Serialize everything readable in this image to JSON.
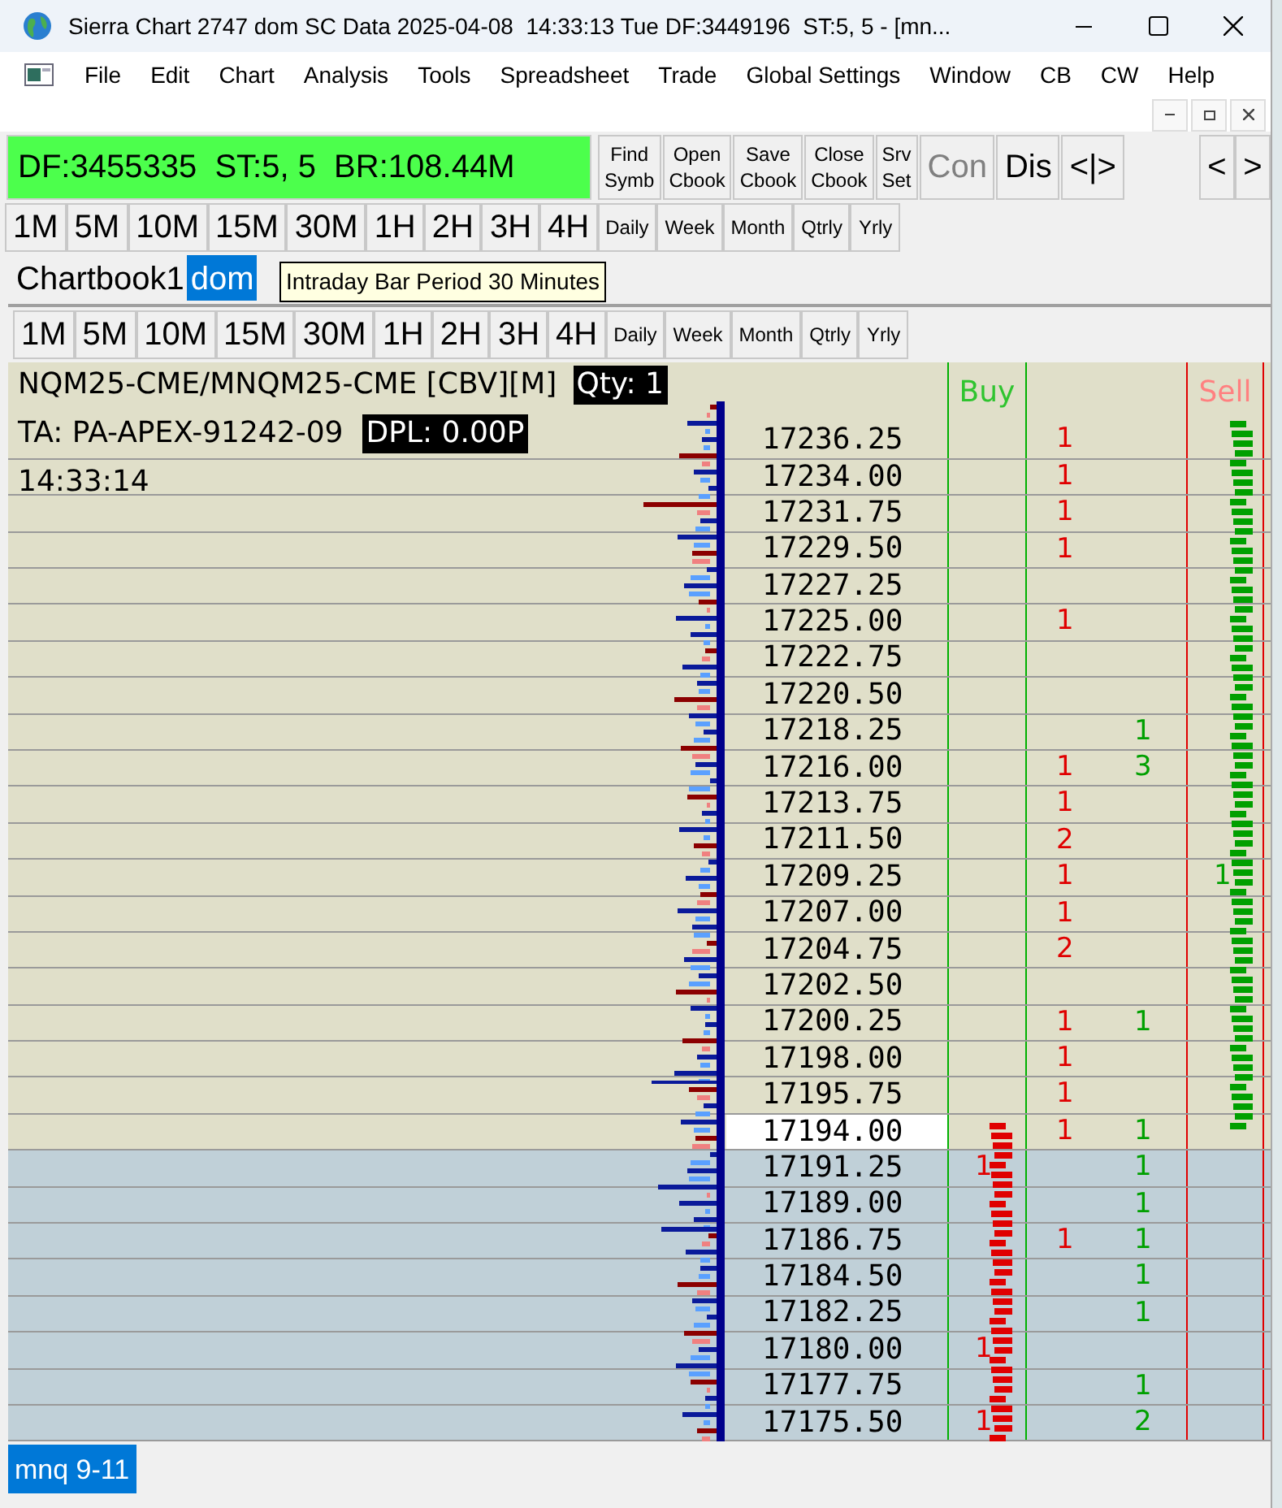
{
  "window": {
    "title": "Sierra Chart 2747 dom SC Data 2025-04-08  14:33:13 Tue DF:3449196  ST:5, 5 - [mn..."
  },
  "menu": [
    "File",
    "Edit",
    "Chart",
    "Analysis",
    "Tools",
    "Spreadsheet",
    "Trade",
    "Global Settings",
    "Window",
    "CB",
    "CW",
    "Help"
  ],
  "toolbar": {
    "status": "DF:3455335  ST:5, 5  BR:108.44M",
    "buttons": [
      {
        "kind": "stacked",
        "lines": [
          "Find",
          "Symb"
        ],
        "disabled": false
      },
      {
        "kind": "stacked",
        "lines": [
          "Open",
          "Cbook"
        ],
        "disabled": false
      },
      {
        "kind": "stacked",
        "lines": [
          "Save",
          "Cbook"
        ],
        "disabled": false
      },
      {
        "kind": "stacked",
        "lines": [
          "Close",
          "Cbook"
        ],
        "disabled": false
      },
      {
        "kind": "stacked",
        "lines": [
          "Srv",
          "Set"
        ],
        "disabled": false
      },
      {
        "kind": "large",
        "lines": [
          "Con"
        ],
        "disabled": true
      },
      {
        "kind": "large",
        "lines": [
          "Dis"
        ],
        "disabled": false
      },
      {
        "kind": "large",
        "lines": [
          "<|>"
        ],
        "disabled": false
      }
    ],
    "nav_buttons": [
      "<",
      ">"
    ]
  },
  "timeframes": [
    {
      "label": "1M",
      "kind": "intraday"
    },
    {
      "label": "5M",
      "kind": "intraday"
    },
    {
      "label": "10M",
      "kind": "intraday"
    },
    {
      "label": "15M",
      "kind": "intraday"
    },
    {
      "label": "30M",
      "kind": "intraday"
    },
    {
      "label": "1H",
      "kind": "intraday"
    },
    {
      "label": "2H",
      "kind": "intraday"
    },
    {
      "label": "3H",
      "kind": "intraday"
    },
    {
      "label": "4H",
      "kind": "intraday"
    },
    {
      "label": "Daily",
      "kind": "historical"
    },
    {
      "label": "Week",
      "kind": "historical"
    },
    {
      "label": "Month",
      "kind": "historical"
    },
    {
      "label": "Qtrly",
      "kind": "historical"
    },
    {
      "label": "Yrly",
      "kind": "historical"
    }
  ],
  "chartbook_tabs": [
    {
      "label": "Chartbook1",
      "selected": false
    },
    {
      "label": "dom",
      "selected": true
    }
  ],
  "tooltip": "Intraday Bar Period 30 Minutes",
  "chart": {
    "timeframes": [
      {
        "label": "1M",
        "kind": "intraday"
      },
      {
        "label": "5M",
        "kind": "intraday"
      },
      {
        "label": "10M",
        "kind": "intraday"
      },
      {
        "label": "15M",
        "kind": "intraday"
      },
      {
        "label": "30M",
        "kind": "intraday"
      },
      {
        "label": "1H",
        "kind": "intraday"
      },
      {
        "label": "2H",
        "kind": "intraday"
      },
      {
        "label": "3H",
        "kind": "intraday"
      },
      {
        "label": "4H",
        "kind": "intraday"
      },
      {
        "label": "Daily",
        "kind": "historical"
      },
      {
        "label": "Week",
        "kind": "historical"
      },
      {
        "label": "Month",
        "kind": "historical"
      },
      {
        "label": "Qtrly",
        "kind": "historical"
      },
      {
        "label": "Yrly",
        "kind": "historical"
      }
    ],
    "symbol": "NQM25-CME/MNQM25-CME [CBV][M]",
    "quantity": "Qty: 1",
    "account": "TA: PA-APEX-91242-09",
    "pnl": "DPL: 0.00P",
    "time": "14:33:14",
    "buy_header": "Buy",
    "sell_header": "Sell",
    "rows": [
      {
        "price": "17236.25",
        "below_market": false,
        "selected": false,
        "bid": "1"
      },
      {
        "price": "17234.00",
        "below_market": false,
        "selected": false,
        "bid": "1"
      },
      {
        "price": "17231.75",
        "below_market": false,
        "selected": false,
        "bid": "1"
      },
      {
        "price": "17229.50",
        "below_market": false,
        "selected": false,
        "bid": "1"
      },
      {
        "price": "17227.25",
        "below_market": false,
        "selected": false
      },
      {
        "price": "17225.00",
        "below_market": false,
        "selected": false,
        "bid": "1"
      },
      {
        "price": "17222.75",
        "below_market": false,
        "selected": false
      },
      {
        "price": "17220.50",
        "below_market": false,
        "selected": false
      },
      {
        "price": "17218.25",
        "below_market": false,
        "selected": false,
        "ask": "1"
      },
      {
        "price": "17216.00",
        "below_market": false,
        "selected": false,
        "bid": "1",
        "ask": "3"
      },
      {
        "price": "17213.75",
        "below_market": false,
        "selected": false,
        "bid": "1"
      },
      {
        "price": "17211.50",
        "below_market": false,
        "selected": false,
        "bid": "2"
      },
      {
        "price": "17209.25",
        "below_market": false,
        "selected": false,
        "bid": "1",
        "sell": "1"
      },
      {
        "price": "17207.00",
        "below_market": false,
        "selected": false,
        "bid": "1"
      },
      {
        "price": "17204.75",
        "below_market": false,
        "selected": false,
        "bid": "2"
      },
      {
        "price": "17202.50",
        "below_market": false,
        "selected": false
      },
      {
        "price": "17200.25",
        "below_market": false,
        "selected": false,
        "bid": "1",
        "ask": "1"
      },
      {
        "price": "17198.00",
        "below_market": false,
        "selected": false,
        "bid": "1"
      },
      {
        "price": "17195.75",
        "below_market": false,
        "selected": false,
        "bid": "1"
      },
      {
        "price": "17194.00",
        "below_market": false,
        "selected": true,
        "bid": "1",
        "ask": "1"
      },
      {
        "price": "17191.25",
        "below_market": true,
        "selected": false,
        "buy": "1",
        "ask": "1"
      },
      {
        "price": "17189.00",
        "below_market": true,
        "selected": false,
        "ask": "1"
      },
      {
        "price": "17186.75",
        "below_market": true,
        "selected": false,
        "bid": "1",
        "ask": "1"
      },
      {
        "price": "17184.50",
        "below_market": true,
        "selected": false,
        "ask": "1"
      },
      {
        "price": "17182.25",
        "below_market": true,
        "selected": false,
        "ask": "1"
      },
      {
        "price": "17180.00",
        "below_market": true,
        "selected": false,
        "buy": "1"
      },
      {
        "price": "17177.75",
        "below_market": true,
        "selected": false,
        "ask": "1"
      },
      {
        "price": "17175.50",
        "below_market": true,
        "selected": false,
        "buy": "1",
        "ask": "2"
      }
    ]
  },
  "taskbar_tabs": [
    {
      "label": "mnq 9-11",
      "selected": true
    }
  ]
}
